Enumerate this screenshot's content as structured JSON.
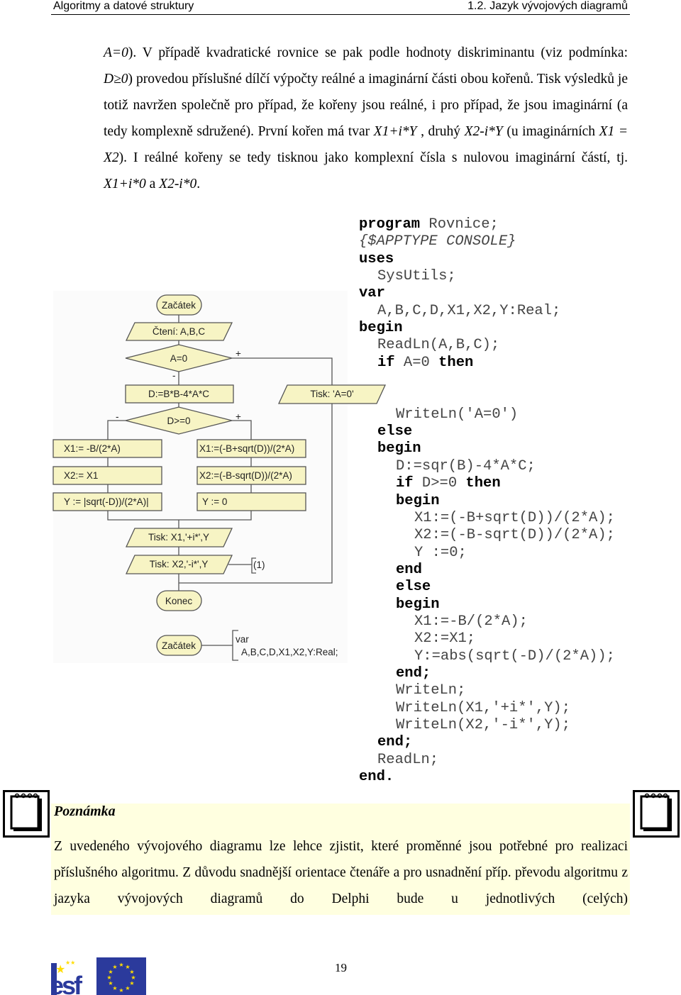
{
  "header": {
    "left": "Algoritmy a datové struktury",
    "right": "1.2. Jazyk vývojových diagramů"
  },
  "paragraph": [
    {
      "text": "A=0",
      "italic": true
    },
    {
      "text": "). V případě kvadratické rovnice se pak podle hodnoty diskriminantu (viz podmínka: ",
      "italic": false
    },
    {
      "text": "D≥0",
      "italic": true
    },
    {
      "text": ") provedou příslušné dílčí výpočty reálné a imaginární části obou kořenů. Tisk výsledků je totiž navržen společně pro případ, že kořeny jsou reálné, i pro případ, že jsou imaginární (a tedy komplexně sdružené). První kořen má tvar ",
      "italic": false
    },
    {
      "text": "X1+i*Y",
      "italic": true
    },
    {
      "text": " , druhý ",
      "italic": false
    },
    {
      "text": "X2-i*Y",
      "italic": true
    },
    {
      "text": " (u imaginárních ",
      "italic": false
    },
    {
      "text": "X1 = X2",
      "italic": true
    },
    {
      "text": "). I reálné kořeny se tedy tisknou jako komplexní čísla s nulovou imaginární částí, tj. ",
      "italic": false
    },
    {
      "text": "X1+i*0",
      "italic": true
    },
    {
      "text": " a ",
      "italic": false
    },
    {
      "text": "X2-i*0",
      "italic": true
    },
    {
      "text": ".",
      "italic": false
    }
  ],
  "code": [
    [
      0,
      [
        [
          "kw",
          "program"
        ],
        [
          "",
          " Rovnice;"
        ]
      ]
    ],
    [
      0,
      [
        [
          "cm",
          "{$APPTYPE CONSOLE}"
        ]
      ]
    ],
    [
      0,
      [
        [
          "kw",
          "uses"
        ]
      ]
    ],
    [
      1,
      [
        [
          "",
          "SysUtils;"
        ]
      ]
    ],
    [
      0,
      [
        [
          "kw",
          "var"
        ]
      ]
    ],
    [
      1,
      [
        [
          "",
          "A,B,C,D,X1,X2,Y:Real;"
        ]
      ]
    ],
    [
      0,
      [
        [
          "kw",
          "begin"
        ]
      ]
    ],
    [
      1,
      [
        [
          "",
          "ReadLn(A,B,C);"
        ]
      ]
    ],
    [
      1,
      [
        [
          "kw",
          "if"
        ],
        [
          "",
          " A=0 "
        ],
        [
          "kw",
          "then"
        ]
      ]
    ],
    [
      0,
      []
    ],
    [
      0,
      []
    ],
    [
      2,
      [
        [
          "",
          "WriteLn('A=0')"
        ]
      ]
    ],
    [
      1,
      [
        [
          "kw",
          "else"
        ]
      ]
    ],
    [
      1,
      [
        [
          "kw",
          "begin"
        ]
      ]
    ],
    [
      2,
      [
        [
          "",
          "D:=sqr(B)-4*A*C;"
        ]
      ]
    ],
    [
      2,
      [
        [
          "kw",
          "if"
        ],
        [
          "",
          " D>=0 "
        ],
        [
          "kw",
          "then"
        ]
      ]
    ],
    [
      2,
      [
        [
          "kw",
          "begin"
        ]
      ]
    ],
    [
      3,
      [
        [
          "",
          "X1:=(-B+sqrt(D))/(2*A);"
        ]
      ]
    ],
    [
      3,
      [
        [
          "",
          "X2:=(-B-sqrt(D))/(2*A);"
        ]
      ]
    ],
    [
      3,
      [
        [
          "",
          "Y :=0;"
        ]
      ]
    ],
    [
      2,
      [
        [
          "kw",
          "end"
        ]
      ]
    ],
    [
      2,
      [
        [
          "kw",
          "else"
        ]
      ]
    ],
    [
      2,
      [
        [
          "kw",
          "begin"
        ]
      ]
    ],
    [
      3,
      [
        [
          "",
          "X1:=-B/(2*A);"
        ]
      ]
    ],
    [
      3,
      [
        [
          "",
          "X2:=X1;"
        ]
      ]
    ],
    [
      3,
      [
        [
          "",
          "Y:=abs(sqrt(-D)/(2*A));"
        ]
      ]
    ],
    [
      2,
      [
        [
          "kw",
          "end;"
        ]
      ]
    ],
    [
      2,
      [
        [
          "",
          "WriteLn;"
        ]
      ]
    ],
    [
      2,
      [
        [
          "",
          "WriteLn(X1,'+i*',Y);"
        ]
      ]
    ],
    [
      2,
      [
        [
          "",
          "WriteLn(X2,'-i*',Y);"
        ]
      ]
    ],
    [
      1,
      [
        [
          "kw",
          "end;"
        ]
      ]
    ],
    [
      1,
      [
        [
          "",
          "ReadLn;"
        ]
      ]
    ],
    [
      0,
      [
        [
          "kw",
          "end."
        ]
      ]
    ]
  ],
  "flowchart": {
    "start": "Začátek",
    "read": "Čtení: A,B,C",
    "cond_a": "A=0",
    "disc": "D:=B*B-4*A*C",
    "print_a0": "Tisk: 'A=0'",
    "cond_d": "D>=0",
    "neg_x1": "X1:= -B/(2*A)",
    "neg_x2": "X2:= X1",
    "neg_y": "Y := |sqrt(-D))/(2*A)|",
    "pos_x1": "X1:=(-B+sqrt(D))/(2*A)",
    "pos_x2": "X2:=(-B-sqrt(D))/(2*A)",
    "pos_y": "Y := 0",
    "print1": "Tisk: X1,'+i*',Y",
    "print2": "Tisk: X2,'-i*',Y",
    "note1": "(1)",
    "end": "Konec",
    "start2": "Začátek",
    "var_kw": "var",
    "var_decl": "A,B,C,D,X1,X2,Y:Real;",
    "plus": "+",
    "minus": "-",
    "fill": "#f7f4c4",
    "stroke": "#555555"
  },
  "note": {
    "title": "Poznámka",
    "text": "Z uvedeného vývojového diagramu lze lehce zjistit, které proměnné jsou potřebné pro realizaci příslušného algoritmu. Z důvodu snadnější orientace čtenáře a pro usnadnění příp. převodu algoritmu z jazyka vývojových diagramů do Delphi bude u jednotlivých (celých)",
    "icon": "notepad-icon",
    "background": "#ffffe0"
  },
  "footer": {
    "page_number": "19",
    "logos": [
      "esf",
      "eu-flag"
    ]
  }
}
